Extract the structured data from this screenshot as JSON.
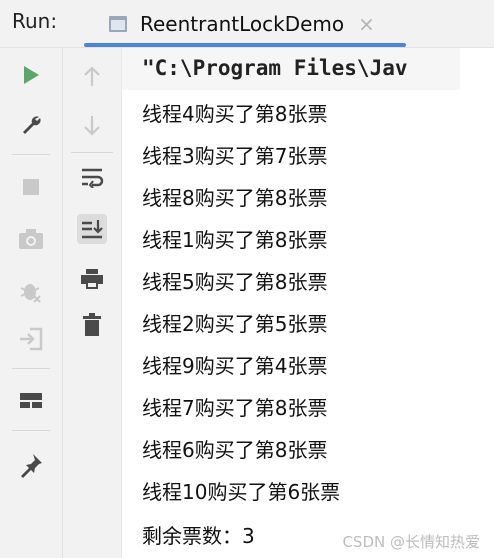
{
  "header": {
    "run_label": "Run:",
    "tab_title": "ReentrantLockDemo",
    "tab_close": "×"
  },
  "console": {
    "command": "\"C:\\Program Files\\Jav",
    "lines": [
      "线程4购买了第8张票",
      "线程3购买了第7张票",
      "线程8购买了第8张票",
      "线程1购买了第8张票",
      "线程5购买了第8张票",
      "线程2购买了第5张票",
      "线程9购买了第4张票",
      "线程7购买了第8张票",
      "线程6购买了第8张票",
      "线程10购买了第6张票",
      "剩余票数：3"
    ]
  },
  "watermark": "CSDN @长情知热爱",
  "icons": {
    "left_toolbar": [
      "run-icon",
      "wrench-icon",
      "stop-icon",
      "camera-icon",
      "bug-icon",
      "login-icon",
      "layout-icon",
      "pin-icon"
    ],
    "right_toolbar": [
      "up-arrow-icon",
      "down-arrow-icon",
      "soft-wrap-icon",
      "scroll-to-end-icon",
      "print-icon",
      "trash-icon"
    ]
  },
  "colors": {
    "accent": "#4c86d8",
    "run_green": "#59a869",
    "icon_gray": "#6e6e6e",
    "toolbar_bg": "#f2f2f2"
  }
}
